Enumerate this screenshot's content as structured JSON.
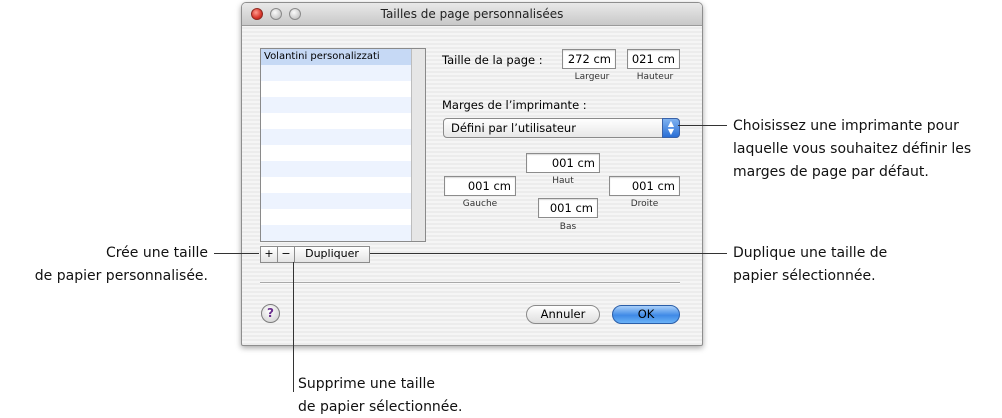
{
  "window": {
    "title": "Tailles de page personnalisées"
  },
  "list": {
    "items": [
      "Volantini personalizzati",
      "",
      "",
      "",
      "",
      "",
      "",
      "",
      "",
      "",
      "",
      ""
    ]
  },
  "page_size": {
    "label": "Taille de la page :",
    "width_value": "272 cm",
    "height_value": "021 cm",
    "width_caption": "Largeur",
    "height_caption": "Hauteur"
  },
  "margins": {
    "label": "Marges de l’imprimante :",
    "popup_value": "Défini par l’utilisateur",
    "top_value": "001 cm",
    "left_value": "001 cm",
    "right_value": "001 cm",
    "bottom_value": "001 cm",
    "top_caption": "Haut",
    "left_caption": "Gauche",
    "right_caption": "Droite",
    "bottom_caption": "Bas"
  },
  "buttons": {
    "add": "+",
    "remove": "−",
    "duplicate": "Dupliquer",
    "help": "?",
    "cancel": "Annuler",
    "ok": "OK"
  },
  "callouts": {
    "printer_line1": "Choisissez une imprimante pour",
    "printer_line2": "laquelle vous souhaitez définir les",
    "printer_line3": "marges de page par défaut.",
    "create_line1": "Crée une taille",
    "create_line2": "de papier personnalisée.",
    "duplicate_line1": "Duplique une taille de",
    "duplicate_line2": "papier sélectionnée.",
    "delete_line1": "Supprime une taille",
    "delete_line2": "de papier sélectionnée."
  },
  "icons": {
    "close": "close-icon",
    "minimize": "minimize-icon",
    "zoom": "zoom-icon",
    "popup_arrows": "up-down-arrows-icon"
  }
}
